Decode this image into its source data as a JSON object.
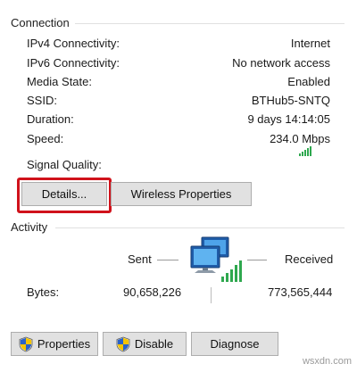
{
  "connection": {
    "title": "Connection",
    "rows": [
      {
        "label": "IPv4 Connectivity:",
        "value": "Internet"
      },
      {
        "label": "IPv6 Connectivity:",
        "value": "No network access"
      },
      {
        "label": "Media State:",
        "value": "Enabled"
      },
      {
        "label": "SSID:",
        "value": "BTHub5-SNTQ"
      },
      {
        "label": "Duration:",
        "value": "9 days 14:14:05"
      },
      {
        "label": "Speed:",
        "value": "234.0 Mbps"
      }
    ],
    "signal_label": "Signal Quality:",
    "signal_bars_filled": 5,
    "signal_bars_total": 5,
    "details_label": "Details...",
    "wireless_label": "Wireless Properties"
  },
  "activity": {
    "title": "Activity",
    "sent_label": "Sent",
    "received_label": "Received",
    "bytes_label": "Bytes:",
    "bytes_sent": "90,658,226",
    "bytes_received": "773,565,444"
  },
  "buttons": {
    "properties_label": "Properties",
    "disable_label": "Disable",
    "diagnose_label": "Diagnose"
  },
  "watermark": "wsxdn.com",
  "colors": {
    "highlight": "#d0121b",
    "signal": "#2fa84f",
    "button_bg": "#e1e1e1"
  }
}
